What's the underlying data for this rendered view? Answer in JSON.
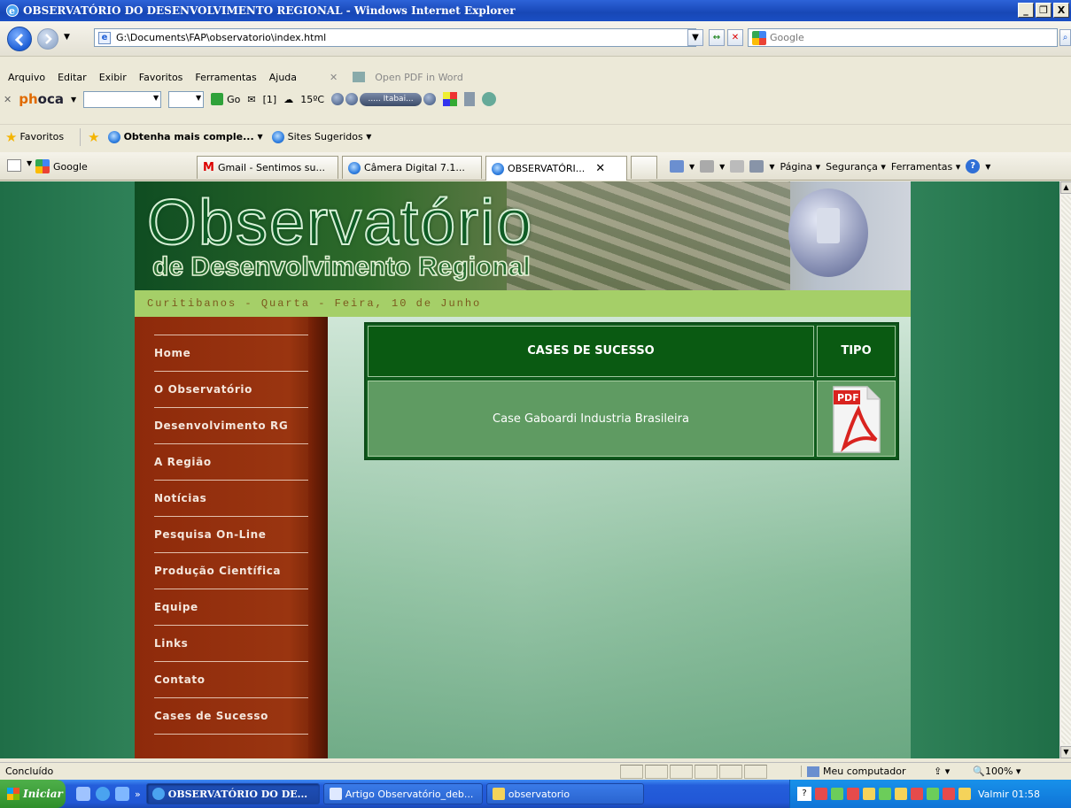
{
  "window": {
    "title": "OBSERVATÓRIO DO DESENVOLVIMENTO REGIONAL - Windows Internet Explorer",
    "controls": [
      "_",
      "❐",
      "X"
    ]
  },
  "address_bar": {
    "url": "G:\\Documents\\FAP\\observatorio\\index.html",
    "search_placeholder": "Google"
  },
  "menu": [
    "Arquivo",
    "Editar",
    "Exibir",
    "Favoritos",
    "Ferramentas",
    "Ajuda"
  ],
  "menu_extra": "Open PDF in Word",
  "toolbar2": {
    "phoca_prefix": "ph",
    "phoca_rest": "oca",
    "go_label": "Go",
    "mail_count": "[1]",
    "weather": "15ºC",
    "radio_station": "..... Itabai..."
  },
  "favorites_bar": {
    "favorites_label": "Favoritos",
    "items": [
      "Obtenha mais comple...",
      "Sites Sugeridos"
    ]
  },
  "tabs": {
    "google": "Google",
    "items": [
      {
        "label": "Gmail - Sentimos su...",
        "icon": "gmail-icon"
      },
      {
        "label": "Câmera Digital 7.1...",
        "icon": "ie-icon"
      },
      {
        "label": "OBSERVATÓRI...",
        "icon": "ie-icon",
        "active": true
      }
    ],
    "commands": [
      "Página",
      "Segurança",
      "Ferramentas"
    ]
  },
  "page": {
    "banner_title": "Observatório",
    "banner_subtitle": "de Desenvolvimento Regional",
    "date_line": "Curitibanos - Quarta - Feira, 10 de Junho",
    "nav": [
      "Home",
      "O Observatório",
      "Desenvolvimento RG",
      "A Região",
      "Notícias",
      "Pesquisa On-Line",
      "Produção Científica",
      "Equipe",
      "Links",
      "Contato",
      "Cases de Sucesso"
    ],
    "table": {
      "col1_header": "CASES DE SUCESSO",
      "col2_header": "TIPO",
      "rows": [
        {
          "name": "Case Gaboardi Industria Brasileira",
          "type_icon": "pdf-icon",
          "type_label": "PDF"
        }
      ]
    }
  },
  "status_bar": {
    "status": "Concluído",
    "zone": "Meu computador",
    "zoom": "100%"
  },
  "taskbar": {
    "start": "Iniciar",
    "buttons": [
      {
        "label": "OBSERVATÓRIO DO DE...",
        "active": true
      },
      {
        "label": "Artigo Observatório_deb...",
        "active": false
      },
      {
        "label": "observatorio",
        "active": false
      }
    ],
    "clock": "Valmir 01:58"
  },
  "colors": {
    "page_bg": "#2a7a52",
    "sidebar": "#9a3510",
    "datebar": "#a5cf68",
    "table_header": "#0a5a12",
    "table_cell": "#5f9b62"
  }
}
